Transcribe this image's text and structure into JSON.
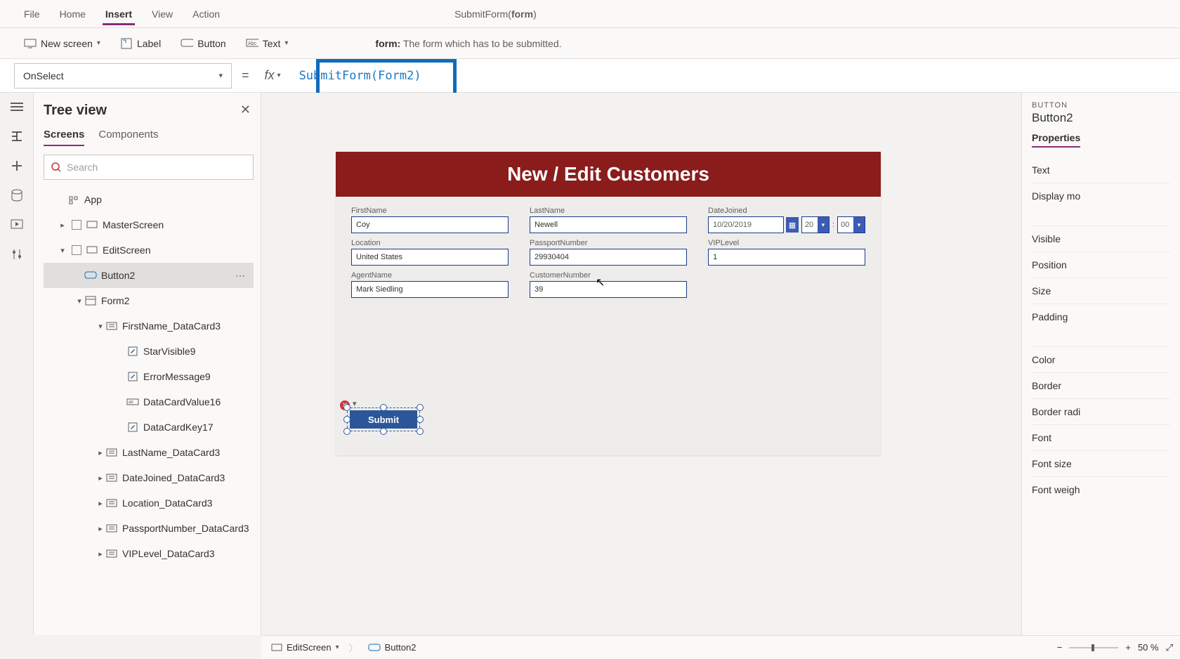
{
  "menu": {
    "file": "File",
    "home": "Home",
    "insert": "Insert",
    "view": "View",
    "action": "Action"
  },
  "signature": {
    "fn": "SubmitForm",
    "arg": "form"
  },
  "ribbon": {
    "newscreen": "New screen",
    "label": "Label",
    "button": "Button",
    "text": "Text",
    "hint_key": "form:",
    "hint_text": "The form which has to be submitted."
  },
  "formula": {
    "prop": "OnSelect",
    "value": "SubmitForm(Form2)"
  },
  "tree": {
    "title": "Tree view",
    "tabs": {
      "screens": "Screens",
      "components": "Components"
    },
    "search_placeholder": "Search",
    "items": [
      {
        "label": "App",
        "indent": 1,
        "toggle": "",
        "cb": false,
        "icon": "app"
      },
      {
        "label": "MasterScreen",
        "indent": 1,
        "toggle": ">",
        "cb": true,
        "icon": "screen"
      },
      {
        "label": "EditScreen",
        "indent": 1,
        "toggle": "v",
        "cb": true,
        "icon": "screen"
      },
      {
        "label": "Button2",
        "indent": 2,
        "toggle": "",
        "cb": false,
        "icon": "button",
        "selected": true,
        "more": true
      },
      {
        "label": "Form2",
        "indent": 2,
        "toggle": "v",
        "cb": false,
        "icon": "form"
      },
      {
        "label": "FirstName_DataCard3",
        "indent": 3,
        "toggle": "v",
        "cb": false,
        "icon": "card"
      },
      {
        "label": "StarVisible9",
        "indent": 4,
        "toggle": "",
        "cb": false,
        "icon": "edit"
      },
      {
        "label": "ErrorMessage9",
        "indent": 4,
        "toggle": "",
        "cb": false,
        "icon": "edit"
      },
      {
        "label": "DataCardValue16",
        "indent": 4,
        "toggle": "",
        "cb": false,
        "icon": "value"
      },
      {
        "label": "DataCardKey17",
        "indent": 4,
        "toggle": "",
        "cb": false,
        "icon": "edit"
      },
      {
        "label": "LastName_DataCard3",
        "indent": 3,
        "toggle": ">",
        "cb": false,
        "icon": "card"
      },
      {
        "label": "DateJoined_DataCard3",
        "indent": 3,
        "toggle": ">",
        "cb": false,
        "icon": "card"
      },
      {
        "label": "Location_DataCard3",
        "indent": 3,
        "toggle": ">",
        "cb": false,
        "icon": "card"
      },
      {
        "label": "PassportNumber_DataCard3",
        "indent": 3,
        "toggle": ">",
        "cb": false,
        "icon": "card"
      },
      {
        "label": "VIPLevel_DataCard3",
        "indent": 3,
        "toggle": ">",
        "cb": false,
        "icon": "card"
      }
    ]
  },
  "canvas": {
    "header": "New / Edit Customers",
    "fields": {
      "firstname": {
        "label": "FirstName",
        "value": "Coy"
      },
      "lastname": {
        "label": "LastName",
        "value": "Newell"
      },
      "datejoined": {
        "label": "DateJoined",
        "date": "10/20/2019",
        "hour": "20",
        "min": "00"
      },
      "location": {
        "label": "Location",
        "value": "United States"
      },
      "passport": {
        "label": "PassportNumber",
        "value": "29930404"
      },
      "vip": {
        "label": "VIPLevel",
        "value": "1"
      },
      "agent": {
        "label": "AgentName",
        "value": "Mark Siedling"
      },
      "custno": {
        "label": "CustomerNumber",
        "value": "39"
      }
    },
    "submit": "Submit"
  },
  "props": {
    "category": "BUTTON",
    "name": "Button2",
    "tab": "Properties",
    "rows": [
      "Text",
      "Display mo",
      "Visible",
      "Position",
      "Size",
      "Padding",
      "Color",
      "Border",
      "Border radi",
      "Font",
      "Font size",
      "Font weigh"
    ]
  },
  "bottom": {
    "crumb1": "EditScreen",
    "crumb2": "Button2",
    "zoom": "50",
    "pct": "%"
  }
}
